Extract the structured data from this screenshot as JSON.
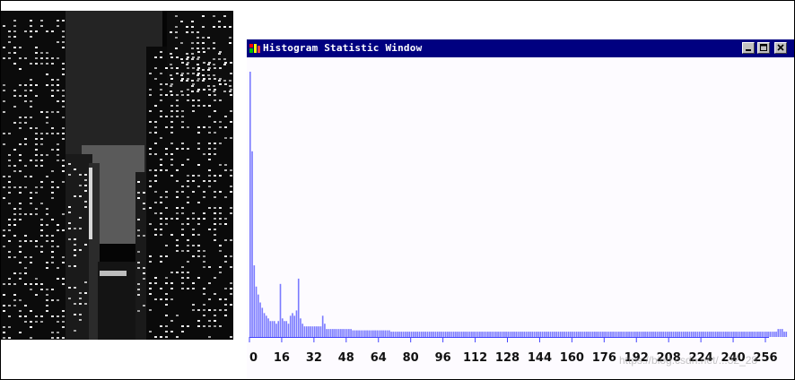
{
  "window": {
    "title": "Histogram Statistic Window",
    "icon": "app-icon",
    "controls": [
      "minimize-icon",
      "maximize-icon",
      "close-icon"
    ]
  },
  "photo": {
    "description_icon": "city-night-image"
  },
  "watermark": "https://blog.csdn.net/...32_28",
  "chart_data": {
    "type": "bar",
    "bar_color": "#7b7bff",
    "axis_color": "#4444ff",
    "xlim": [
      0,
      256
    ],
    "x_tick_labels": [
      "0",
      "16",
      "32",
      "48",
      "64",
      "80",
      "96",
      "112",
      "128",
      "144",
      "160",
      "176",
      "192",
      "208",
      "224",
      "240",
      "256"
    ],
    "x_ticks": [
      0,
      16,
      32,
      48,
      64,
      80,
      96,
      112,
      128,
      144,
      160,
      176,
      192,
      208,
      224,
      240,
      256
    ],
    "values": [
      1.0,
      0.7,
      0.27,
      0.19,
      0.16,
      0.13,
      0.11,
      0.09,
      0.08,
      0.07,
      0.06,
      0.06,
      0.06,
      0.05,
      0.06,
      0.2,
      0.07,
      0.06,
      0.06,
      0.05,
      0.08,
      0.09,
      0.08,
      0.1,
      0.22,
      0.07,
      0.05,
      0.04,
      0.04,
      0.04,
      0.04,
      0.04,
      0.04,
      0.04,
      0.04,
      0.04,
      0.08,
      0.05,
      0.03,
      0.03,
      0.03,
      0.03,
      0.03,
      0.03,
      0.03,
      0.03,
      0.03,
      0.03,
      0.03,
      0.03,
      0.03,
      0.025,
      0.025,
      0.025,
      0.025,
      0.025,
      0.025,
      0.025,
      0.025,
      0.025,
      0.025,
      0.025,
      0.025,
      0.025,
      0.025,
      0.025,
      0.025,
      0.025,
      0.025,
      0.025,
      0.02,
      0.02,
      0.02,
      0.02,
      0.02,
      0.02,
      0.02,
      0.02,
      0.02,
      0.02,
      0.02,
      0.02,
      0.02,
      0.02,
      0.02,
      0.02,
      0.02,
      0.02,
      0.02,
      0.02,
      0.02,
      0.02,
      0.02,
      0.02,
      0.02,
      0.02,
      0.02,
      0.02,
      0.02,
      0.02,
      0.02,
      0.02,
      0.02,
      0.02,
      0.02,
      0.02,
      0.02,
      0.02,
      0.02,
      0.02,
      0.02,
      0.02,
      0.02,
      0.02,
      0.02,
      0.02,
      0.02,
      0.02,
      0.02,
      0.02,
      0.02,
      0.02,
      0.02,
      0.02,
      0.02,
      0.02,
      0.02,
      0.02,
      0.02,
      0.02,
      0.02,
      0.02,
      0.02,
      0.02,
      0.02,
      0.02,
      0.02,
      0.02,
      0.02,
      0.02,
      0.02,
      0.02,
      0.02,
      0.02,
      0.02,
      0.02,
      0.02,
      0.02,
      0.02,
      0.02,
      0.02,
      0.02,
      0.02,
      0.02,
      0.02,
      0.02,
      0.02,
      0.02,
      0.02,
      0.02,
      0.02,
      0.02,
      0.02,
      0.02,
      0.02,
      0.02,
      0.02,
      0.02,
      0.02,
      0.02,
      0.02,
      0.02,
      0.02,
      0.02,
      0.02,
      0.02,
      0.02,
      0.02,
      0.02,
      0.02,
      0.02,
      0.02,
      0.02,
      0.02,
      0.02,
      0.02,
      0.02,
      0.02,
      0.02,
      0.02,
      0.02,
      0.02,
      0.02,
      0.02,
      0.02,
      0.02,
      0.02,
      0.02,
      0.02,
      0.02,
      0.02,
      0.02,
      0.02,
      0.02,
      0.02,
      0.02,
      0.02,
      0.02,
      0.02,
      0.02,
      0.02,
      0.02,
      0.02,
      0.02,
      0.02,
      0.02,
      0.02,
      0.02,
      0.02,
      0.02,
      0.02,
      0.02,
      0.02,
      0.02,
      0.02,
      0.02,
      0.02,
      0.02,
      0.02,
      0.02,
      0.02,
      0.02,
      0.02,
      0.02,
      0.02,
      0.02,
      0.02,
      0.02,
      0.02,
      0.02,
      0.02,
      0.02,
      0.02,
      0.02,
      0.02,
      0.02,
      0.02,
      0.02,
      0.02,
      0.02,
      0.02,
      0.02,
      0.02,
      0.02,
      0.02,
      0.02,
      0.02,
      0.02,
      0.02,
      0.02,
      0.02,
      0.02,
      0.03,
      0.03,
      0.03,
      0.02,
      0.02
    ]
  }
}
